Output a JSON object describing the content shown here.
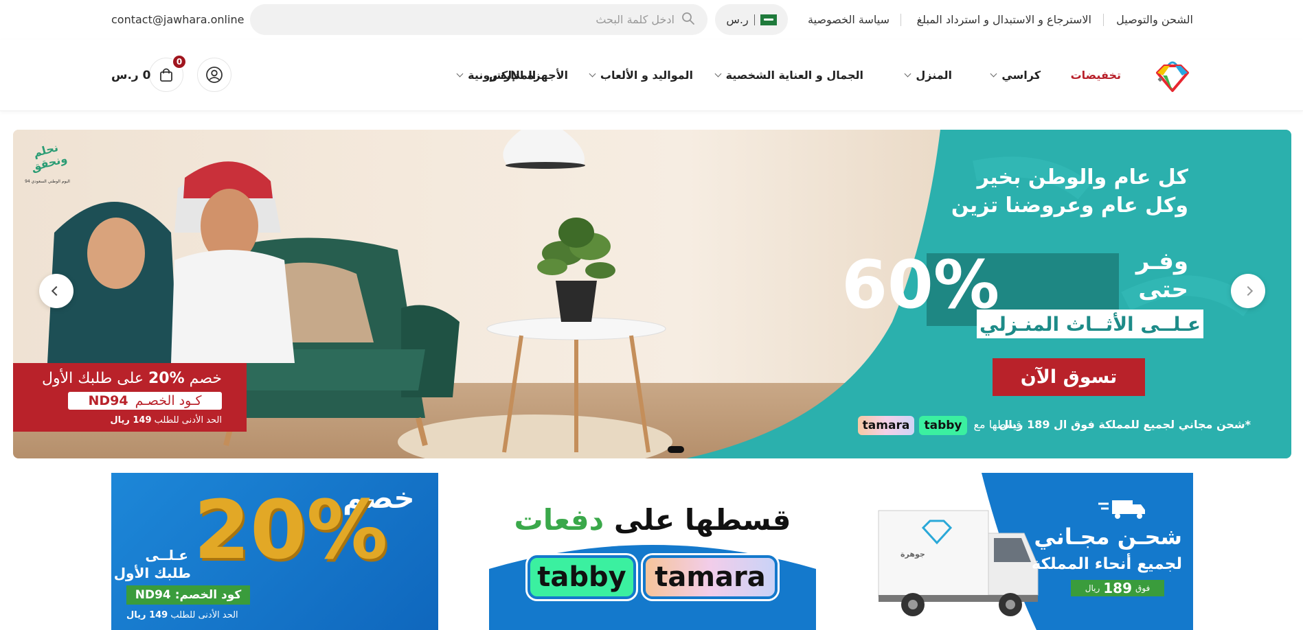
{
  "topbar": {
    "links": [
      "الشحن والتوصيل",
      "الاسترجاع و الاستبدال و استرداد المبلغ",
      "سياسة الخصوصية"
    ],
    "currency": "ر.س",
    "search_placeholder": "ادخل كلمة البحث",
    "email": "contact@jawhara.online"
  },
  "nav": {
    "items": [
      {
        "label": "تخفيضات",
        "has_dropdown": false
      },
      {
        "label": "كراسي",
        "has_dropdown": true
      },
      {
        "label": "المنزل",
        "has_dropdown": true
      },
      {
        "label": "الجمال و العناية الشخصية",
        "has_dropdown": true
      },
      {
        "label": "المواليد و الألعاب",
        "has_dropdown": true
      },
      {
        "label": "الأجهزة الإلكترونية",
        "has_dropdown": true
      },
      {
        "label": "المدارس",
        "has_dropdown": false
      }
    ],
    "cart_count": "0",
    "cart_total": "0 ر.س"
  },
  "hero": {
    "headline_1": "كل عام والوطن بخير",
    "headline_2": "وكل عام وعروضنا تزين",
    "save_word_1": "وفـر",
    "save_word_2": "حتى",
    "percent": "60%",
    "subtitle": "عـلــى الأثــاث المنـزلي",
    "cta": "تسوق الآن",
    "installments": "قسطها مع",
    "tabby": "tabby",
    "tamara": "tamara",
    "shipping_note": "*شحن مجاني لجميع للمملكة فوق ال 189 ريال",
    "promo_title_pre": "خصم",
    "promo_percent": "20%",
    "promo_title_post": "على طلبك الأول",
    "promo_code_label": "كـود الخصـم",
    "promo_code": "ND94",
    "promo_min_pre": "الحد الأدنى للطلب",
    "promo_min_value": "149 ريال",
    "stamp_1": "نحلم ونحقق",
    "stamp_2": "اليوم الوطني السعودي 94"
  },
  "banners": {
    "left": {
      "word": "خصم",
      "percent": "20%",
      "on": "عـلــى",
      "first_order": "طلبك الأول",
      "code_label": "كود الخصم:",
      "code": "ND94",
      "min_pre": "الحد الأدنى للطلب",
      "min_value": "149 ريال"
    },
    "middle": {
      "title_1": "قسطها على",
      "title_2": "دفعات",
      "tabby": "tabby",
      "tamara": "tamara"
    },
    "right": {
      "title": "شحـن مجـاني",
      "subtitle": "لجميع أنحاء المملكة",
      "above": "فوق",
      "amount": "189",
      "currency": "ريال",
      "truck_brand": "جوهرة"
    }
  },
  "colors": {
    "brand_red": "#b9222a",
    "teal": "#2bb0ad",
    "banner_blue": "#1479cc",
    "tabby_green": "#3bf0a0"
  }
}
